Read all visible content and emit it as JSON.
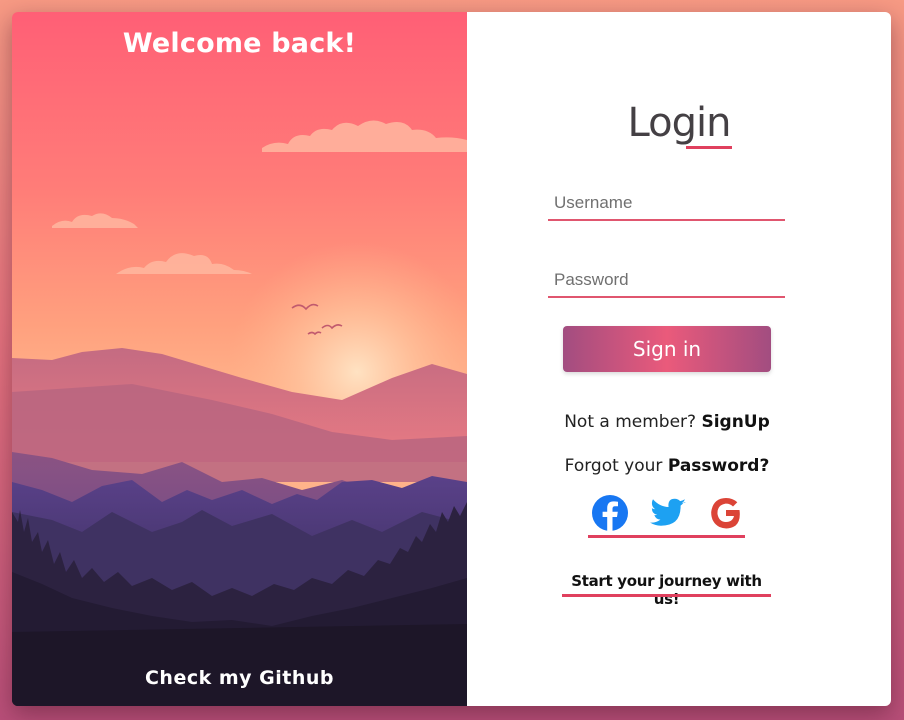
{
  "hero": {
    "welcome": "Welcome back!",
    "github_link": "Check my Github"
  },
  "login": {
    "title": "Login",
    "username_placeholder": "Username",
    "password_placeholder": "Password",
    "signin_label": "Sign in",
    "member_prefix": "Not a member? ",
    "member_link": "SignUp",
    "forgot_prefix": "Forgot your ",
    "forgot_link": "Password?",
    "journey": "Start your journey with us!"
  },
  "socials": [
    {
      "name": "facebook",
      "icon": "facebook-icon",
      "color": "#1877f2"
    },
    {
      "name": "twitter",
      "icon": "twitter-icon",
      "color": "#1da1f2"
    },
    {
      "name": "google",
      "icon": "google-icon",
      "color": "#db4437"
    }
  ],
  "colors": {
    "accent": "#e0405e",
    "button_start": "#a24d80",
    "button_mid": "#ea5a7b"
  }
}
